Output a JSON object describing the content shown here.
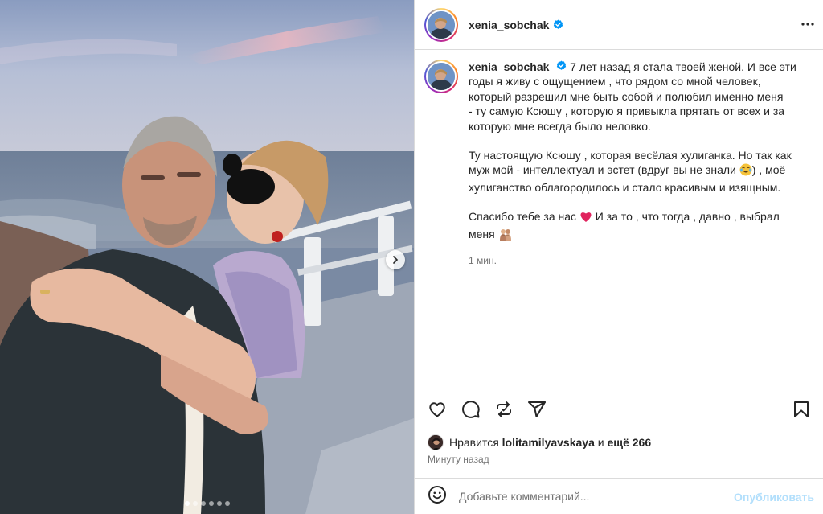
{
  "post": {
    "username": "xenia_sobchak",
    "verified": true,
    "caption": {
      "lines_1": [
        "7 лет назад я стала твоей женой. И все эти",
        "годы я живу с ощущением , что рядом со мной человек,",
        "который разрешил мне быть собой и полюбил именно меня",
        "- ту самую Ксюшу , которую я привыкла прятать от всех и за",
        "которую мне всегда было неловко."
      ],
      "para2_a": "Ту настоящую Ксюшу , которая весёлая хулиганка. Но так как",
      "para2_b": "муж мой - интеллектуал и эстет (вдруг вы не знали ",
      "para2_c": ") , моё",
      "para2_d": "хулиганство облагородилось и стало красивым и изящным.",
      "para3_a": "Спасибо тебе за нас ",
      "para3_b": " И за то , что тогда , давно , выбрал",
      "para3_c": "меня ",
      "time": "1 мин."
    },
    "likes": {
      "prefix": "Нравится",
      "user": "lolitamilyavskaya",
      "conj": "и",
      "others": "ещё 266"
    },
    "posted_ago": "Минуту назад",
    "comment": {
      "placeholder": "Добавьте комментарий...",
      "publish_label": "Опубликовать"
    },
    "carousel": {
      "slides": 6,
      "active_index": 0
    }
  },
  "icons": {
    "more": "more-horizontal-icon",
    "like": "heart-icon",
    "comment": "comment-icon",
    "repost": "repost-icon",
    "share": "send-icon",
    "save": "bookmark-icon",
    "emoji": "emoji-icon",
    "next": "chevron-right-icon"
  },
  "colors": {
    "verified": "#0095f6",
    "publish_disabled": "#b2dffc",
    "heart_emoji": "#e0245e"
  }
}
